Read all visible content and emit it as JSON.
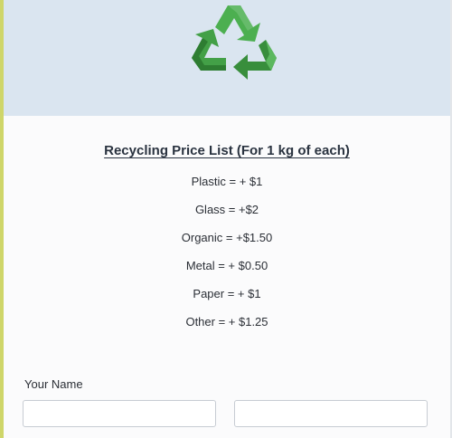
{
  "header": {
    "logo_icon": "recycling-symbol-icon",
    "banner_color": "#dae5f0",
    "logo_color": "#43a047"
  },
  "price_list": {
    "title": "Recycling Price List (For 1 kg of each)",
    "items": [
      {
        "text": "Plastic = + $1"
      },
      {
        "text": "Glass = +$2"
      },
      {
        "text": "Organic = +$1.50"
      },
      {
        "text": "Metal = + $0.50"
      },
      {
        "text": "Paper = + $1"
      },
      {
        "text": "Other = + $1.25"
      }
    ]
  },
  "name_field": {
    "label": "Your Name",
    "first_value": "",
    "last_value": ""
  },
  "accent_color": "#cfd66a"
}
